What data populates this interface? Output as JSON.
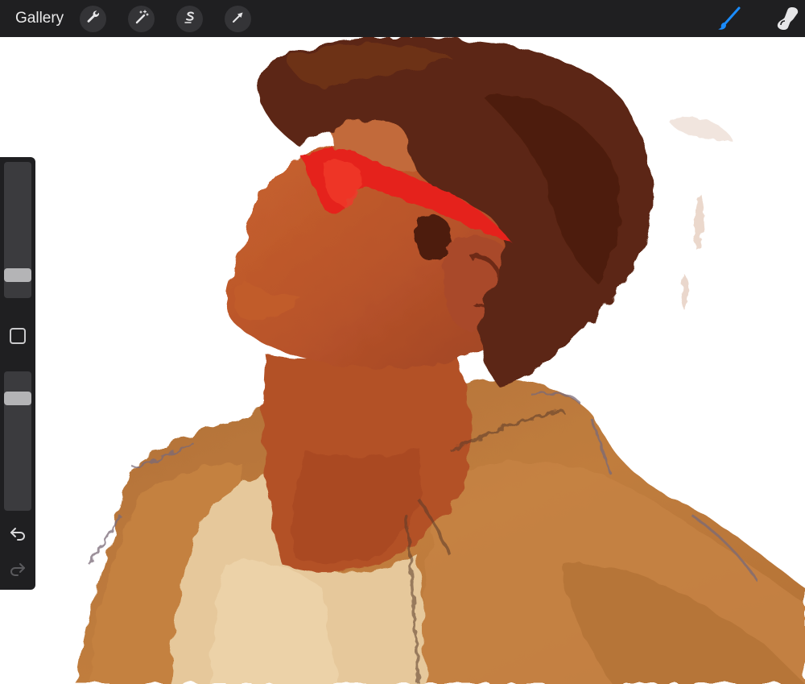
{
  "toolbar": {
    "gallery_label": "Gallery",
    "left_tools": [
      "wrench-icon",
      "magic-wand-icon",
      "selection-s-icon",
      "arrow-cursor-icon"
    ],
    "right_tools": [
      "brush-icon",
      "smudge-icon"
    ],
    "active_tool": "brush",
    "accent_color": "#1a8cff"
  },
  "sidebar": {
    "brush_size": 0.13,
    "opacity": 0.84,
    "undo_enabled": true,
    "redo_enabled": false
  },
  "colors": {
    "background": "#ffffff",
    "chrome": "#1f1f21",
    "sunglasses": "#e5221b",
    "hair": "#5b2512",
    "skin": "#b5562a",
    "jacket": "#bd7a3c",
    "shirt": "#e6c89b"
  }
}
